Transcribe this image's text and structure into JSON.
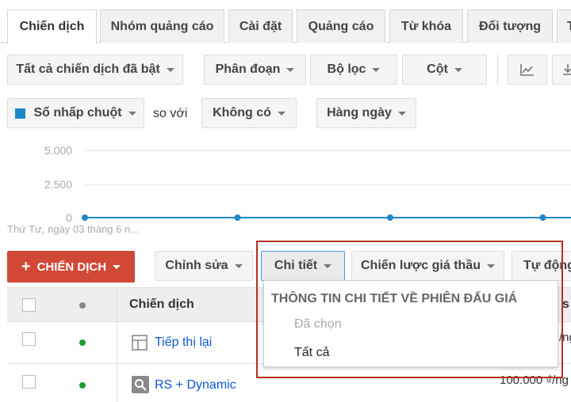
{
  "tabs": [
    {
      "label": "Chiến dịch",
      "active": true
    },
    {
      "label": "Nhóm quảng cáo"
    },
    {
      "label": "Cài đặt"
    },
    {
      "label": "Quảng cáo"
    },
    {
      "label": "Từ khóa"
    },
    {
      "label": "Đối tượng"
    },
    {
      "label": "T"
    }
  ],
  "toolbar1": {
    "filter_label": "Tất cả chiến dịch đã bật",
    "segment_label": "Phân đoạn",
    "filter2_label": "Bộ lọc",
    "columns_label": "Cột"
  },
  "toolbar2": {
    "metric_label": "Số nhấp chuột",
    "metric_color": "#1e88c8",
    "compare_text": "so với",
    "compare_label": "Không có",
    "period_label": "Hàng ngày"
  },
  "chart": {
    "y_ticks": [
      "5.000",
      "2.500",
      "0"
    ],
    "date_caption": "Thứ Tư, ngày 03 tháng 6 n...",
    "line_color": "#1e88c8"
  },
  "chart_data": {
    "type": "line",
    "series": [
      {
        "values": [
          0,
          0,
          0,
          0
        ]
      }
    ],
    "ylim": [
      0,
      5000
    ]
  },
  "actions": {
    "create_label": "CHIẾN DỊCH",
    "create_color": "#d14836",
    "edit_label": "Chỉnh sửa",
    "details_label": "Chi tiết",
    "bid_strategy_label": "Chiến lược giá thầu",
    "auto_label": "Tự động"
  },
  "table": {
    "header_campaign": "Chiến dịch",
    "rows": [
      {
        "name": "Tiếp thị lại",
        "status_color": "#1a9e3a",
        "icon": "display-campaign-icon",
        "budget": "/ng"
      },
      {
        "name": "RS + Dynamic",
        "status_color": "#1a9e3a",
        "icon": "search-campaign-icon",
        "budget": "100.000 ₫/ng"
      }
    ]
  },
  "dropdown": {
    "header": "THÔNG TIN CHI TIẾT VỀ PHIÊN ĐẤU GIÁ",
    "items": [
      "Đã chọn",
      "Tất cả"
    ]
  },
  "header_partial": "s"
}
